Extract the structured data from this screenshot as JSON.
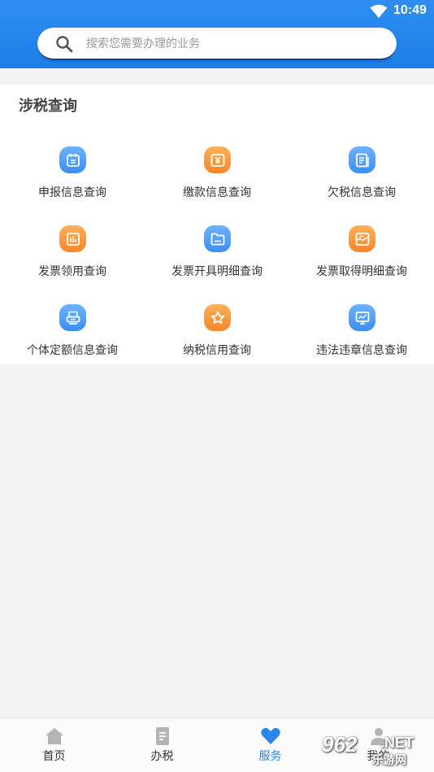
{
  "status_bar": {
    "time": "10:49",
    "wifi_icon": "wifi-icon"
  },
  "search": {
    "placeholder": "搜索您需要办理的业务",
    "value": ""
  },
  "section": {
    "title": "涉税查询"
  },
  "grid": [
    {
      "label": "申报信息查询",
      "icon": "calendar-icon",
      "color": "blue"
    },
    {
      "label": "缴款信息查询",
      "icon": "yuan-icon",
      "color": "orange"
    },
    {
      "label": "欠税信息查询",
      "icon": "document-icon",
      "color": "blue"
    },
    {
      "label": "发票领用查询",
      "icon": "invoice-chart-icon",
      "color": "orange"
    },
    {
      "label": "发票开具明细查询",
      "icon": "folder-icon",
      "color": "blue"
    },
    {
      "label": "发票取得明细查询",
      "icon": "envelope-icon",
      "color": "orange"
    },
    {
      "label": "个体定额信息查询",
      "icon": "printer-icon",
      "color": "blue"
    },
    {
      "label": "纳税信用查询",
      "icon": "star-icon",
      "color": "orange"
    },
    {
      "label": "违法违章信息查询",
      "icon": "monitor-icon",
      "color": "blue"
    }
  ],
  "nav": [
    {
      "label": "首页",
      "icon": "home-icon",
      "active": false
    },
    {
      "label": "办税",
      "icon": "clipboard-icon",
      "active": false
    },
    {
      "label": "服务",
      "icon": "heart-icon",
      "active": true
    },
    {
      "label": "我的",
      "icon": "user-icon",
      "active": false
    }
  ],
  "watermark": {
    "num": "962",
    "net": ".NET",
    "site": "乐游网"
  },
  "colors": {
    "header": "#1c7ee8",
    "blue_icon": "#3c8ef5",
    "orange_icon": "#f6862a",
    "active_nav": "#2b86ec"
  }
}
